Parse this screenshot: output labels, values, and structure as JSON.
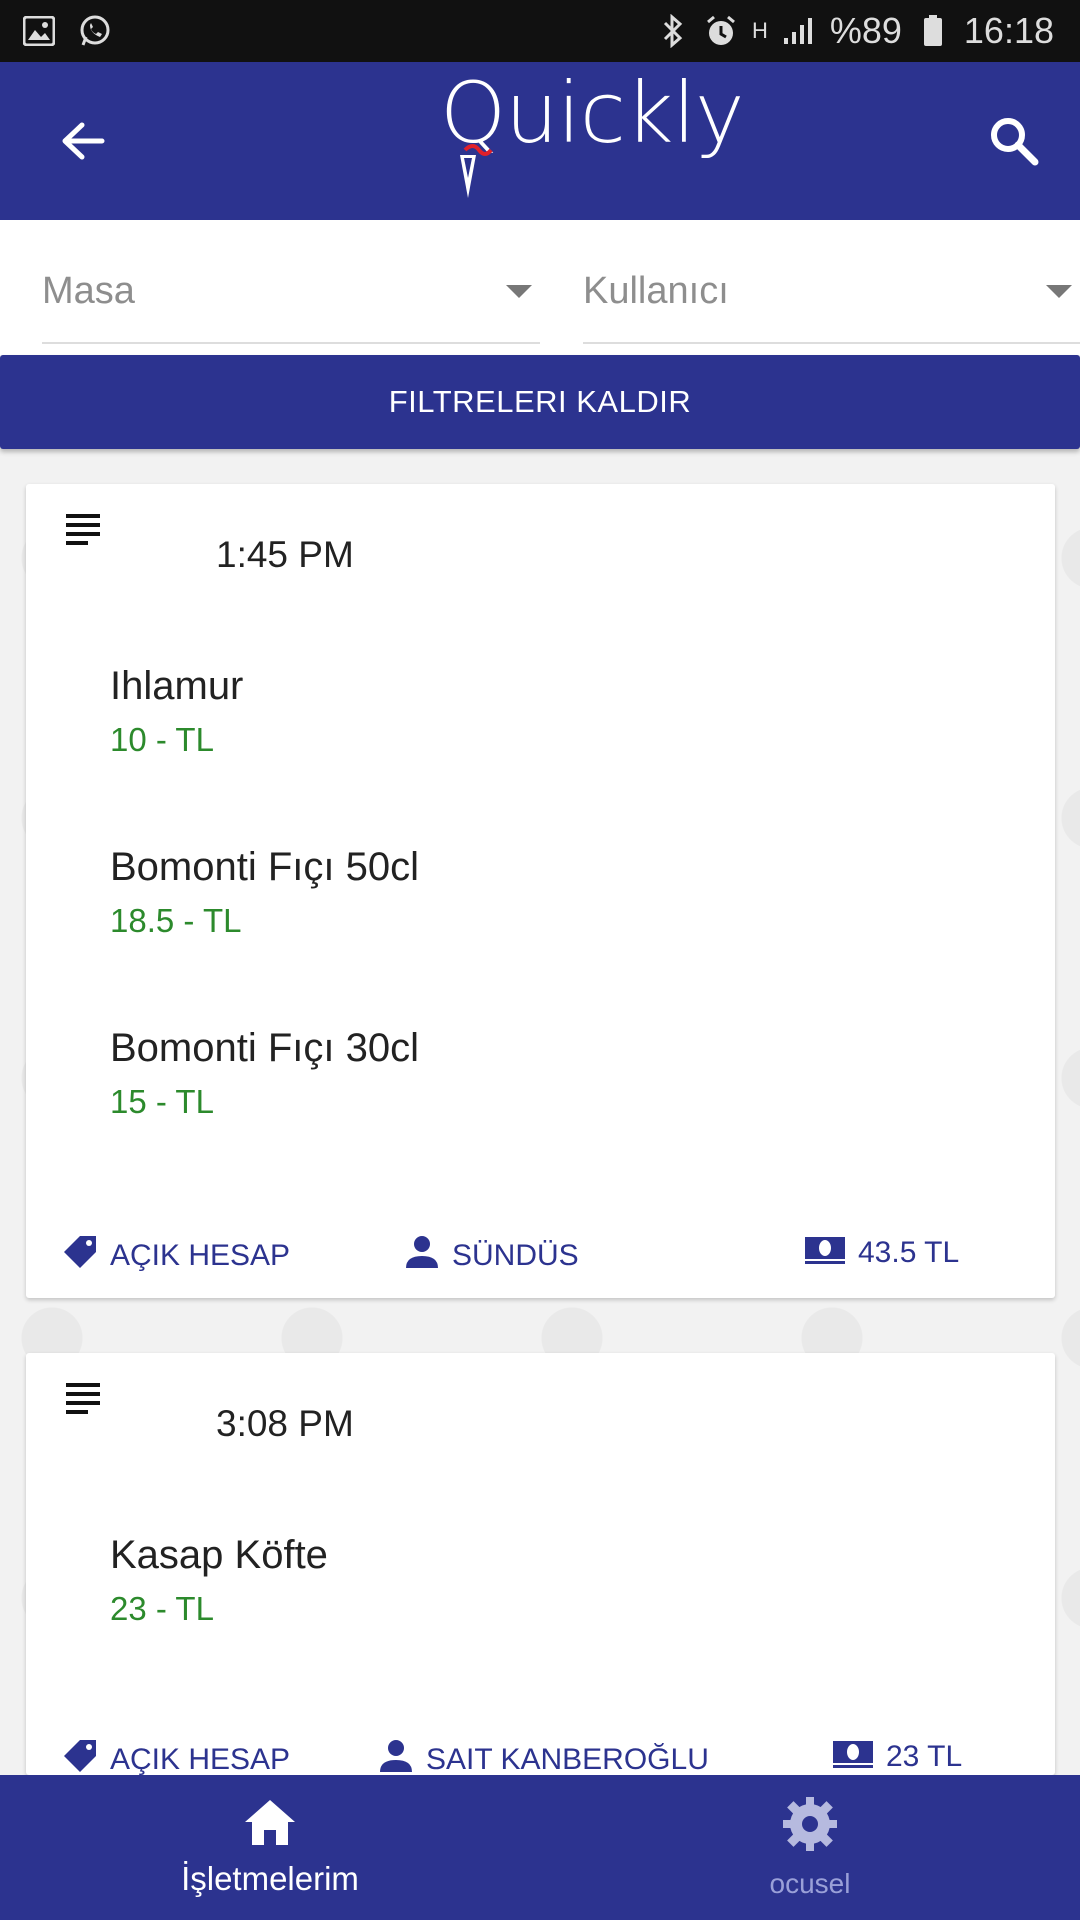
{
  "status_bar": {
    "battery": "%89",
    "time": "16:18",
    "network_indicator": "H"
  },
  "header": {
    "logo_text": "Quickly"
  },
  "filters": {
    "table_placeholder": "Masa",
    "user_placeholder": "Kullanıcı",
    "clear_label": "FILTRELERI KALDIR"
  },
  "orders": [
    {
      "time": "1:45 PM",
      "items": [
        {
          "name": "Ihlamur",
          "price": "10 - TL"
        },
        {
          "name": "Bomonti Fıçı 50cl",
          "price": "18.5 - TL"
        },
        {
          "name": "Bomonti Fıçı 30cl",
          "price": "15 - TL"
        }
      ],
      "status": "AÇIK HESAP",
      "user": "SÜNDÜS",
      "total": "43.5 TL"
    },
    {
      "time": "3:08 PM",
      "items": [
        {
          "name": "Kasap Köfte",
          "price": "23 - TL"
        }
      ],
      "status": "AÇIK HESAP",
      "user": "SAIT KANBEROĞLU",
      "total": "23 TL"
    }
  ],
  "bottom_nav": {
    "home_label": "İşletmelerim",
    "settings_label": "ocusel"
  },
  "colors": {
    "primary": "#2c338f",
    "price_green": "#2c8a2c"
  }
}
